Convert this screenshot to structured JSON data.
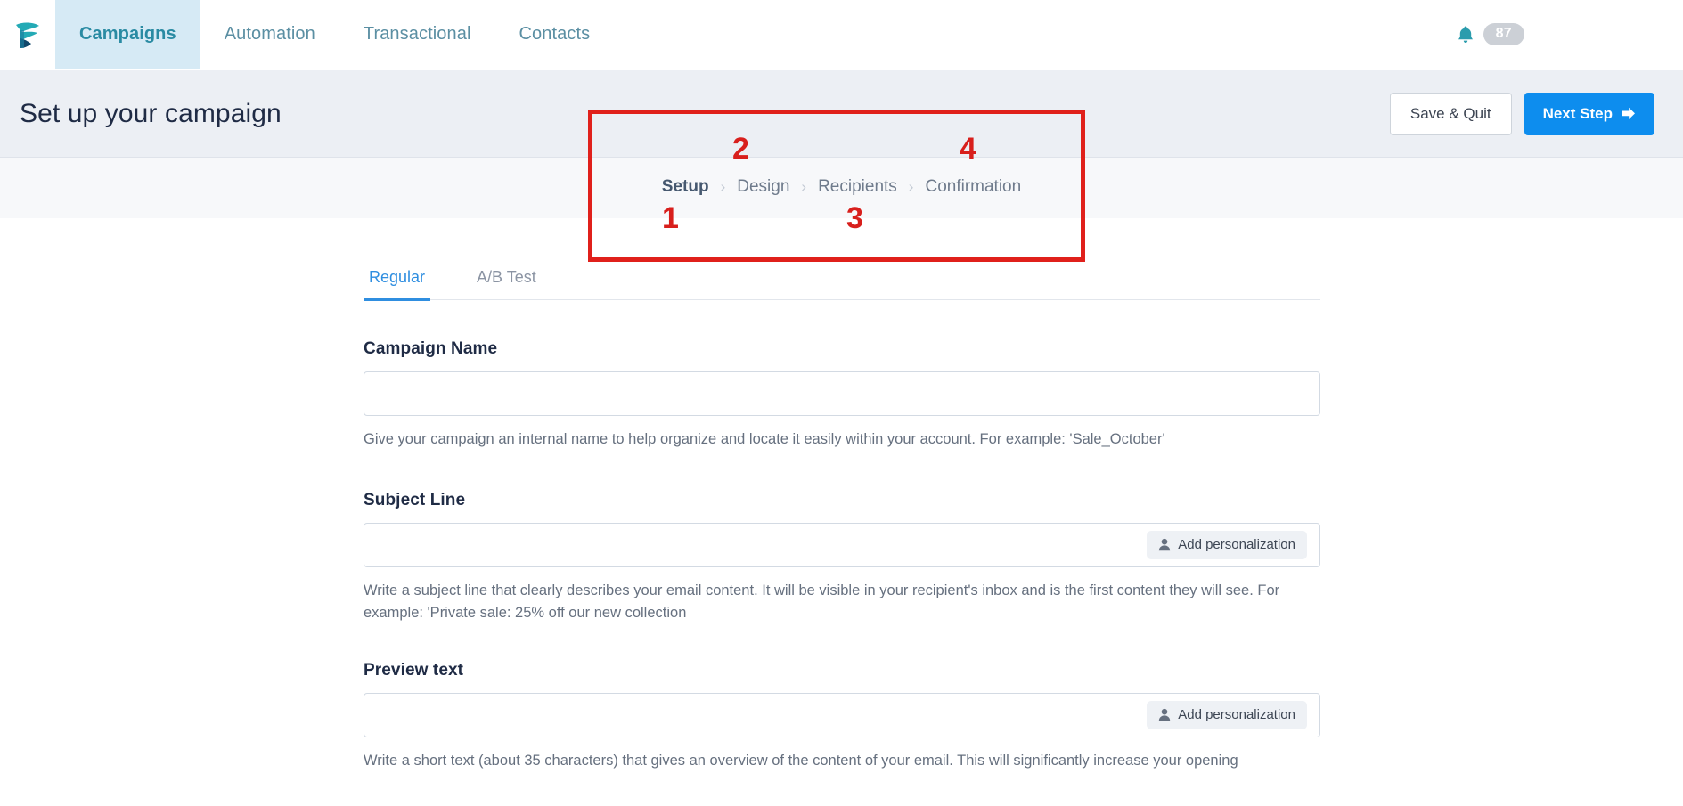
{
  "topnav": {
    "logo_name": "sendinblue-logo",
    "items": [
      {
        "label": "Campaigns",
        "active": true
      },
      {
        "label": "Automation",
        "active": false
      },
      {
        "label": "Transactional",
        "active": false
      },
      {
        "label": "Contacts",
        "active": false
      }
    ],
    "notifications": {
      "icon": "bell-icon",
      "count": "87"
    }
  },
  "header": {
    "title": "Set up your campaign",
    "save_quit_label": "Save & Quit",
    "next_step_label": "Next Step",
    "next_step_icon": "arrow-right-icon",
    "colors": {
      "primary_button": "#0d8dee",
      "band_background": "#eceff4",
      "title_text": "#1f2b45"
    }
  },
  "breadcrumb": {
    "separator": "›",
    "steps": [
      {
        "label": "Setup",
        "active": true
      },
      {
        "label": "Design",
        "active": false
      },
      {
        "label": "Recipients",
        "active": false
      },
      {
        "label": "Confirmation",
        "active": false
      }
    ]
  },
  "annotations": {
    "box_color": "#e0201b",
    "numbers": [
      "1",
      "2",
      "3",
      "4"
    ]
  },
  "tabs": [
    {
      "label": "Regular",
      "active": true
    },
    {
      "label": "A/B Test",
      "active": false
    }
  ],
  "form": {
    "campaign_name": {
      "label": "Campaign Name",
      "value": "",
      "placeholder": "",
      "helper": "Give your campaign an internal name to help organize and locate it easily within your account. For example: 'Sale_October'"
    },
    "subject_line": {
      "label": "Subject Line",
      "value": "",
      "placeholder": "",
      "personalization_label": "Add personalization",
      "personalization_icon": "person-icon",
      "helper": "Write a subject line that clearly describes your email content. It will be visible in your recipient's inbox and is the first content they will see. For example: 'Private sale: 25% off our new collection"
    },
    "preview_text": {
      "label": "Preview text",
      "value": "",
      "placeholder": "",
      "personalization_label": "Add personalization",
      "personalization_icon": "person-icon",
      "helper": "Write a short text (about 35 characters) that gives an overview of the content of your email. This will significantly increase your opening"
    }
  }
}
